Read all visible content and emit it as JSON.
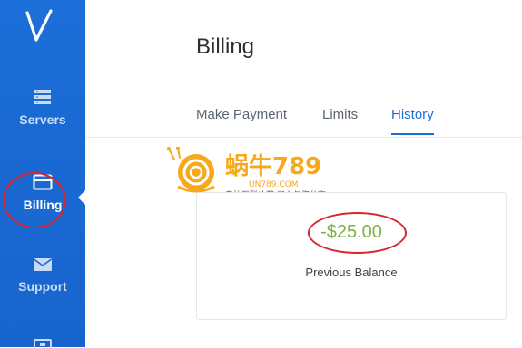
{
  "sidebar": {
    "items": [
      {
        "label": "Servers",
        "icon": "servers-icon"
      },
      {
        "label": "Billing",
        "icon": "card-icon",
        "active": true
      },
      {
        "label": "Support",
        "icon": "envelope-icon"
      },
      {
        "label": "",
        "icon": "document-icon"
      }
    ]
  },
  "header": {
    "title": "Billing"
  },
  "tabs": [
    {
      "label": "Make Payment"
    },
    {
      "label": "Limits"
    },
    {
      "label": "History",
      "active": true
    }
  ],
  "watermark": {
    "brand": "蜗牛789",
    "url": "UN789.COM",
    "slogan": "专注互联收藏  用心与您分享"
  },
  "balance": {
    "amount": "-$25.00",
    "label": "Previous Balance"
  },
  "colors": {
    "sidebar": "#1a68d2",
    "accent": "#1a6fd4",
    "amount": "#7cb342",
    "annotation": "#d8262e"
  }
}
